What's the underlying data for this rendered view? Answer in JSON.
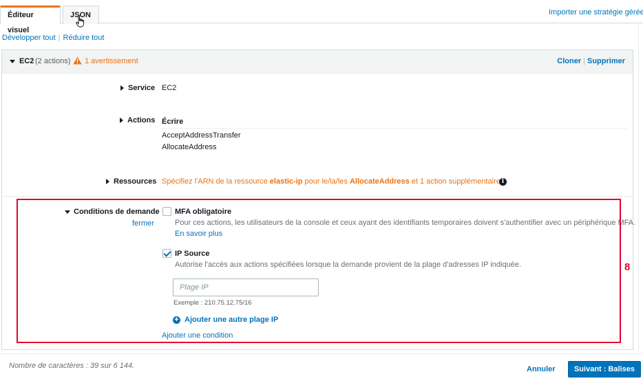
{
  "tabs": {
    "visual": "Éditeur visuel",
    "json": "JSON"
  },
  "import_link": "Importer une stratégie gérée",
  "toolbar": {
    "expand_all": "Développer tout",
    "collapse_all": "Réduire tout",
    "separator": "|"
  },
  "header": {
    "service": "EC2",
    "count": "(2 actions)",
    "warning": "1 avertissement",
    "clone": "Cloner",
    "delete": "Supprimer",
    "separator": "|"
  },
  "service": {
    "label": "Service",
    "value": "EC2"
  },
  "actions": {
    "label": "Actions",
    "access_level": "Écrire",
    "items": [
      "AcceptAddressTransfer",
      "AllocateAddress"
    ]
  },
  "resources": {
    "label": "Ressources",
    "text_1": "Spécifiez l'ARN de la ressource ",
    "bold_1": "elastic-ip",
    "text_2": " pour le/la/les ",
    "bold_2": "AllocateAddress",
    "text_3": " et 1 action supplémentaire."
  },
  "conditions": {
    "label": "Conditions de demande",
    "close_link": "fermer",
    "mfa": {
      "label": "MFA obligatoire",
      "checked": false,
      "description": "Pour ces actions, les utilisateurs de la console et ceux ayant des identifiants temporaires doivent s'authentifier avec un périphérique MFA.",
      "learn_more": "En savoir plus"
    },
    "ip_source": {
      "label": "IP Source",
      "checked": true,
      "description": "Autorise l'accès aux actions spécifiées lorsque la demande provient de la plage d'adresses IP indiquée.",
      "input_placeholder": "Plage IP",
      "input_value": "",
      "example": "Exemple : 210.75.12.75/16",
      "add_range": "Ajouter une autre plage IP"
    },
    "add_condition": "Ajouter une condition"
  },
  "annotation": {
    "number": "8",
    "color": "#e4002b"
  },
  "footer": {
    "char_count": "Nombre de caractères : 39 sur 6 144.",
    "cancel": "Annuler",
    "next": "Suivant : Balises"
  },
  "colors": {
    "accent": "#ec7211",
    "link": "#0073bb",
    "primary_button": "#0073bb"
  }
}
